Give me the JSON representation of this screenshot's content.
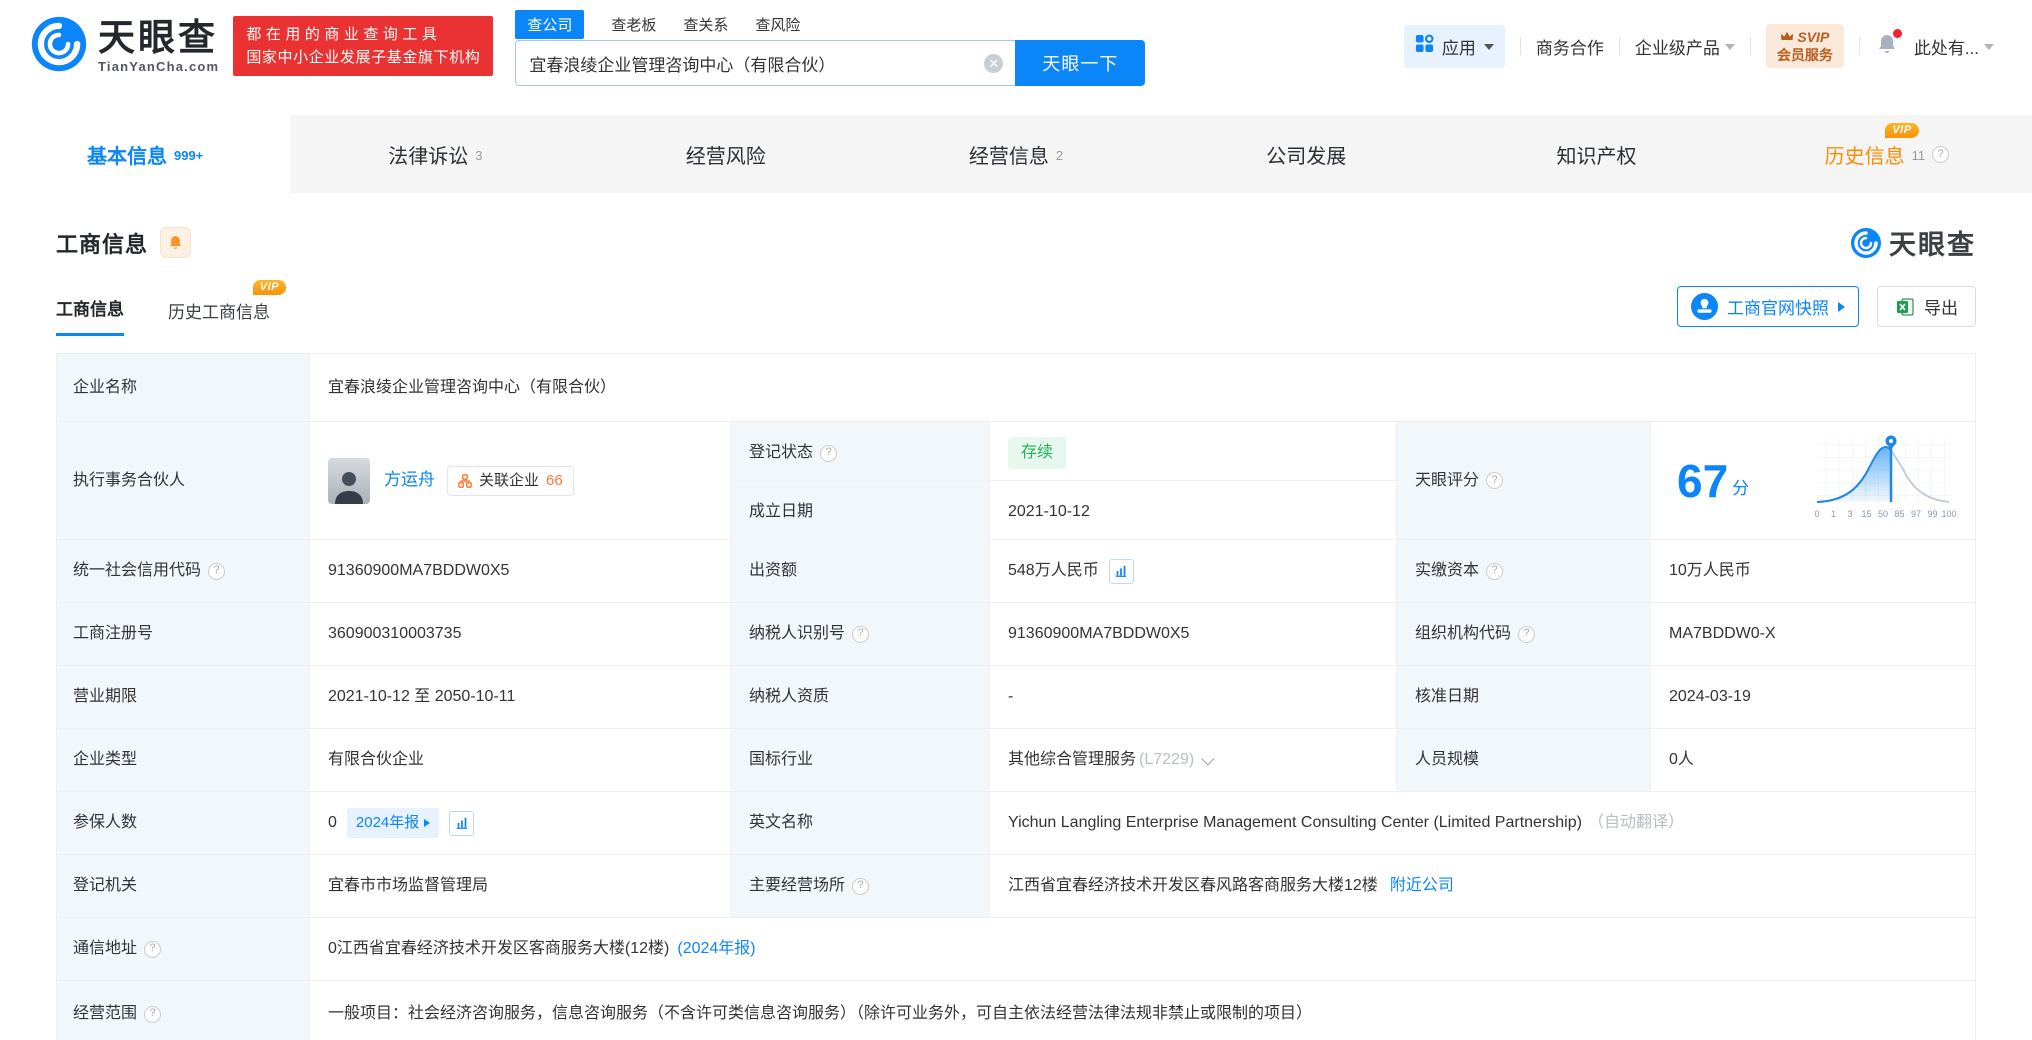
{
  "header": {
    "brand": {
      "name": "天眼查",
      "domain": "TianYanCha.com"
    },
    "slogan": {
      "line1": "都在用的商业查询工具",
      "line2": "国家中小企业发展子基金旗下机构"
    },
    "search": {
      "tabs": [
        {
          "label": "查公司"
        },
        {
          "label": "查老板"
        },
        {
          "label": "查关系"
        },
        {
          "label": "查风险"
        }
      ],
      "value": "宜春浪绫企业管理咨询中心（有限合伙）",
      "button": "天眼一下"
    },
    "nav": {
      "apps": "应用",
      "cooperation": "商务合作",
      "enterprise": "企业级产品",
      "vip_top": "SVIP",
      "vip_bottom": "会员服务",
      "account": "此处有..."
    }
  },
  "nav_tabs": [
    {
      "label": "基本信息",
      "count": "999+"
    },
    {
      "label": "法律诉讼",
      "count": "3"
    },
    {
      "label": "经营风险",
      "count": ""
    },
    {
      "label": "经营信息",
      "count": "2"
    },
    {
      "label": "公司发展",
      "count": ""
    },
    {
      "label": "知识产权",
      "count": ""
    },
    {
      "label": "历史信息",
      "count": "11",
      "vip": "VIP"
    }
  ],
  "section": {
    "title": "工商信息",
    "watermark": "天眼查",
    "subtabs": [
      {
        "label": "工商信息"
      },
      {
        "label": "历史工商信息",
        "vip": "VIP"
      }
    ],
    "snapshot_button": "工商官网快照",
    "export_button": "导出"
  },
  "company": {
    "name": {
      "label": "企业名称",
      "value": "宜春浪绫企业管理咨询中心（有限合伙）"
    },
    "partner": {
      "label": "执行事务合伙人",
      "person": "方运舟",
      "related_label": "关联企业",
      "related_count": "66"
    },
    "reg_status": {
      "label": "登记状态",
      "value": "存续"
    },
    "establish_date": {
      "label": "成立日期",
      "value": "2021-10-12"
    },
    "score": {
      "label": "天眼评分",
      "value": "67",
      "unit": "分"
    },
    "credit_code": {
      "label": "统一社会信用代码",
      "value": "91360900MA7BDDW0X5"
    },
    "capital": {
      "label": "出资额",
      "value": "548万人民币"
    },
    "paid_capital": {
      "label": "实缴资本",
      "value": "10万人民币"
    },
    "reg_number": {
      "label": "工商注册号",
      "value": "360900310003735"
    },
    "taxpayer_id": {
      "label": "纳税人识别号",
      "value": "91360900MA7BDDW0X5"
    },
    "org_code": {
      "label": "组织机构代码",
      "value": "MA7BDDW0-X"
    },
    "business_term": {
      "label": "营业期限",
      "value": "2021-10-12 至 2050-10-11"
    },
    "taxpayer_quality": {
      "label": "纳税人资质",
      "value": "-"
    },
    "approval_date": {
      "label": "核准日期",
      "value": "2024-03-19"
    },
    "company_type": {
      "label": "企业类型",
      "value": "有限合伙企业"
    },
    "industry": {
      "label": "国标行业",
      "value": "其他综合管理服务",
      "code": "(L7229)"
    },
    "staff_size": {
      "label": "人员规模",
      "value": "0人"
    },
    "insured": {
      "label": "参保人数",
      "value": "0",
      "report": "2024年报"
    },
    "english_name": {
      "label": "英文名称",
      "value": "Yichun Langling Enterprise Management Consulting Center (Limited Partnership)",
      "note": "（自动翻译）"
    },
    "reg_authority": {
      "label": "登记机关",
      "value": "宜春市市场监督管理局"
    },
    "business_place": {
      "label": "主要经营场所",
      "value": "江西省宜春经济技术开发区春风路客商服务大楼12楼",
      "link": "附近公司"
    },
    "mail_address": {
      "label": "通信地址",
      "value": "0江西省宜春经济技术开发区客商服务大楼(12楼)",
      "link": "(2024年报)"
    },
    "business_scope": {
      "label": "经营范围",
      "value": "一般项目：社会经济咨询服务，信息咨询服务（不含许可类信息咨询服务）（除许可业务外，可自主依法经营法律法规非禁止或限制的项目）"
    }
  },
  "chart_data": {
    "type": "area",
    "title": "天眼评分分布曲线",
    "score": 67,
    "unit": "分",
    "x_ticks": [
      "0",
      "1",
      "3",
      "15",
      "50",
      "85",
      "97",
      "99",
      "100"
    ],
    "marker_position": 67,
    "curve": "normal-distribution",
    "highlight_color": "#1f87e8",
    "rest_color": "#c6ccd6",
    "grid": true
  }
}
